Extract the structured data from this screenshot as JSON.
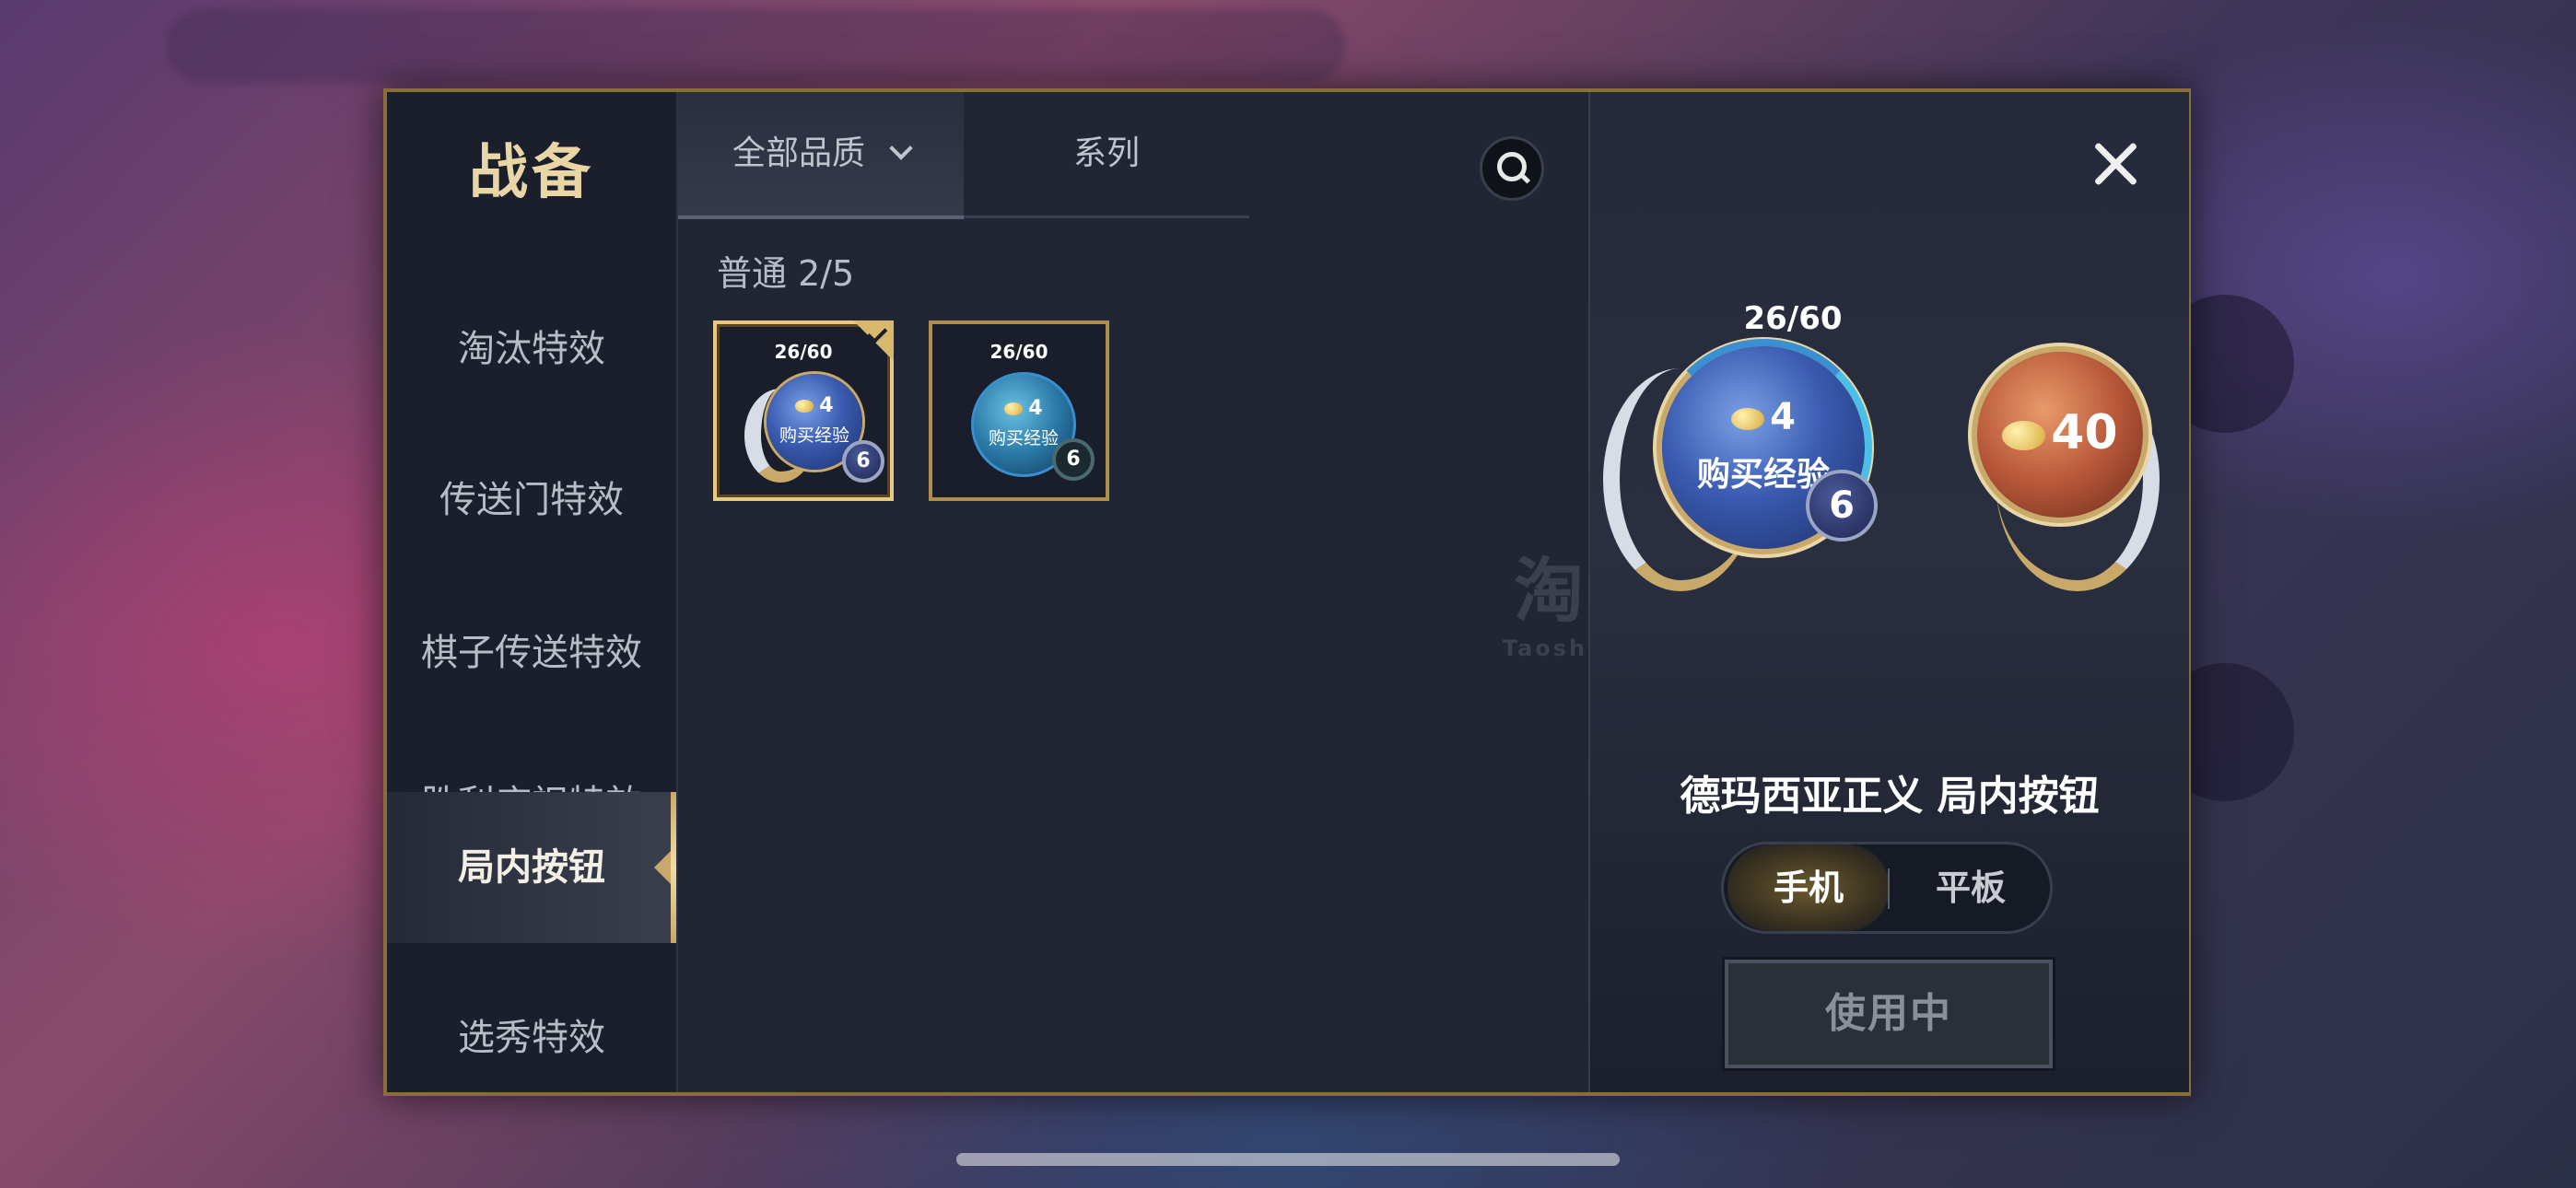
{
  "sidebar": {
    "title": "战备",
    "items": [
      {
        "label": "淘汰特效"
      },
      {
        "label": "传送门特效"
      },
      {
        "label": "棋子传送特效"
      },
      {
        "label": "胜利庆祝特效"
      },
      {
        "label": "局内按钮"
      },
      {
        "label": "选秀特效"
      }
    ],
    "active_index": 4
  },
  "filters": {
    "quality_label": "全部品质",
    "series_label": "系列"
  },
  "section": {
    "label": "普通 2/5"
  },
  "items": [
    {
      "progress": "26/60",
      "cost": "4",
      "action": "购买经验",
      "level": "6",
      "selected": true
    },
    {
      "progress": "26/60",
      "cost": "4",
      "action": "购买经验",
      "level": "6",
      "selected": false
    }
  ],
  "watermark": {
    "main": "淘手游",
    "sub": "Taoshouyou.Com"
  },
  "preview": {
    "progress": "26/60",
    "cost": "4",
    "action": "购买经验",
    "level": "6",
    "alt_value": "40",
    "name": "德玛西亚正义 局内按钮",
    "device_options": [
      "手机",
      "平板"
    ],
    "device_selected": "手机",
    "use_button": "使用中"
  },
  "colors": {
    "frame_gold": "#8a6d3b",
    "accent_gold": "#e8c982",
    "panel": "#1e2230"
  }
}
